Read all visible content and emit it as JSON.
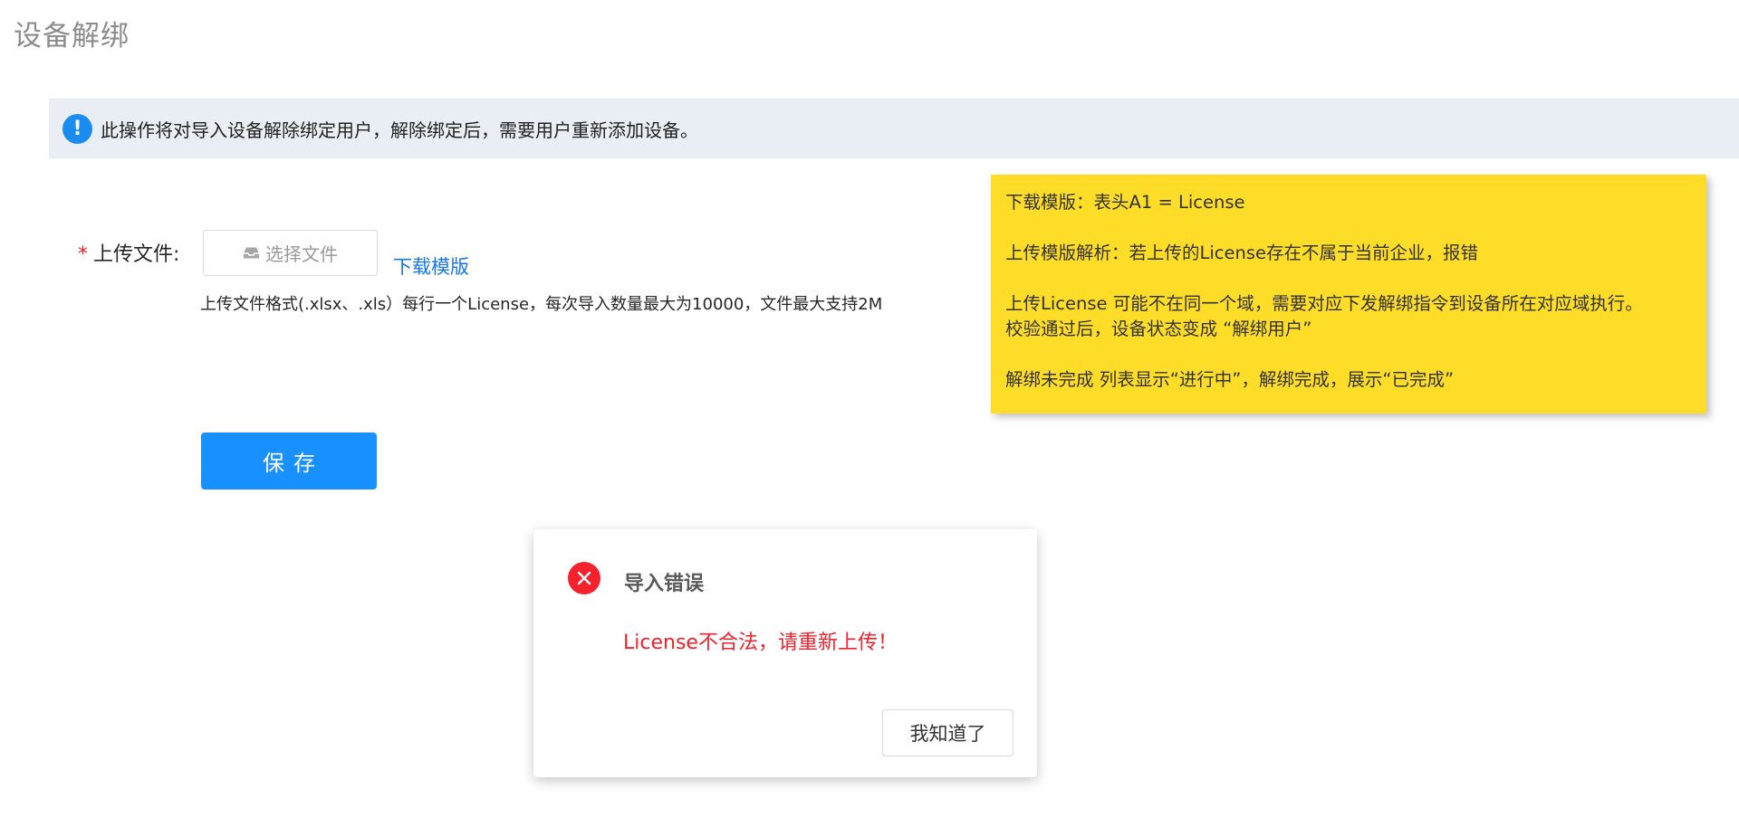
{
  "page": {
    "title": "设备解绑"
  },
  "banner": {
    "icon": "info-circle-icon",
    "icon_glyph": "!",
    "text": "此操作将对导入设备解除绑定用户，解除绑定后，需要用户重新添加设备。"
  },
  "form": {
    "required_mark": "*",
    "upload_label": "上传文件:",
    "file_button_label": "选择文件",
    "file_button_icon": "inbox-icon",
    "download_link": "下载模版",
    "upload_hint": "上传文件格式(.xlsx、.xls）每行一个License，每次导入数量最大为10000，文件最大支持2M",
    "save_label": "保存"
  },
  "note": {
    "line1": "下载模版：表头A1 = License",
    "line2": "上传模版解析：若上传的License存在不属于当前企业，报错",
    "line3": "上传License 可能不在同一个域，需要对应下发解绑指令到设备所在对应域执行。",
    "line4": "校验通过后，设备状态变成 “解绑用户”",
    "line5": "解绑未完成 列表显示“进行中”，解绑完成，展示“已完成”"
  },
  "modal": {
    "icon": "error-circle-icon",
    "title": "导入错误",
    "message": "License不合法，请重新上传！",
    "ok_label": "我知道了"
  },
  "colors": {
    "primary": "#1890ff",
    "link": "#1677e6",
    "error": "#f5222d",
    "banner_bg": "#e9eef5",
    "note_bg": "#fedd28"
  }
}
